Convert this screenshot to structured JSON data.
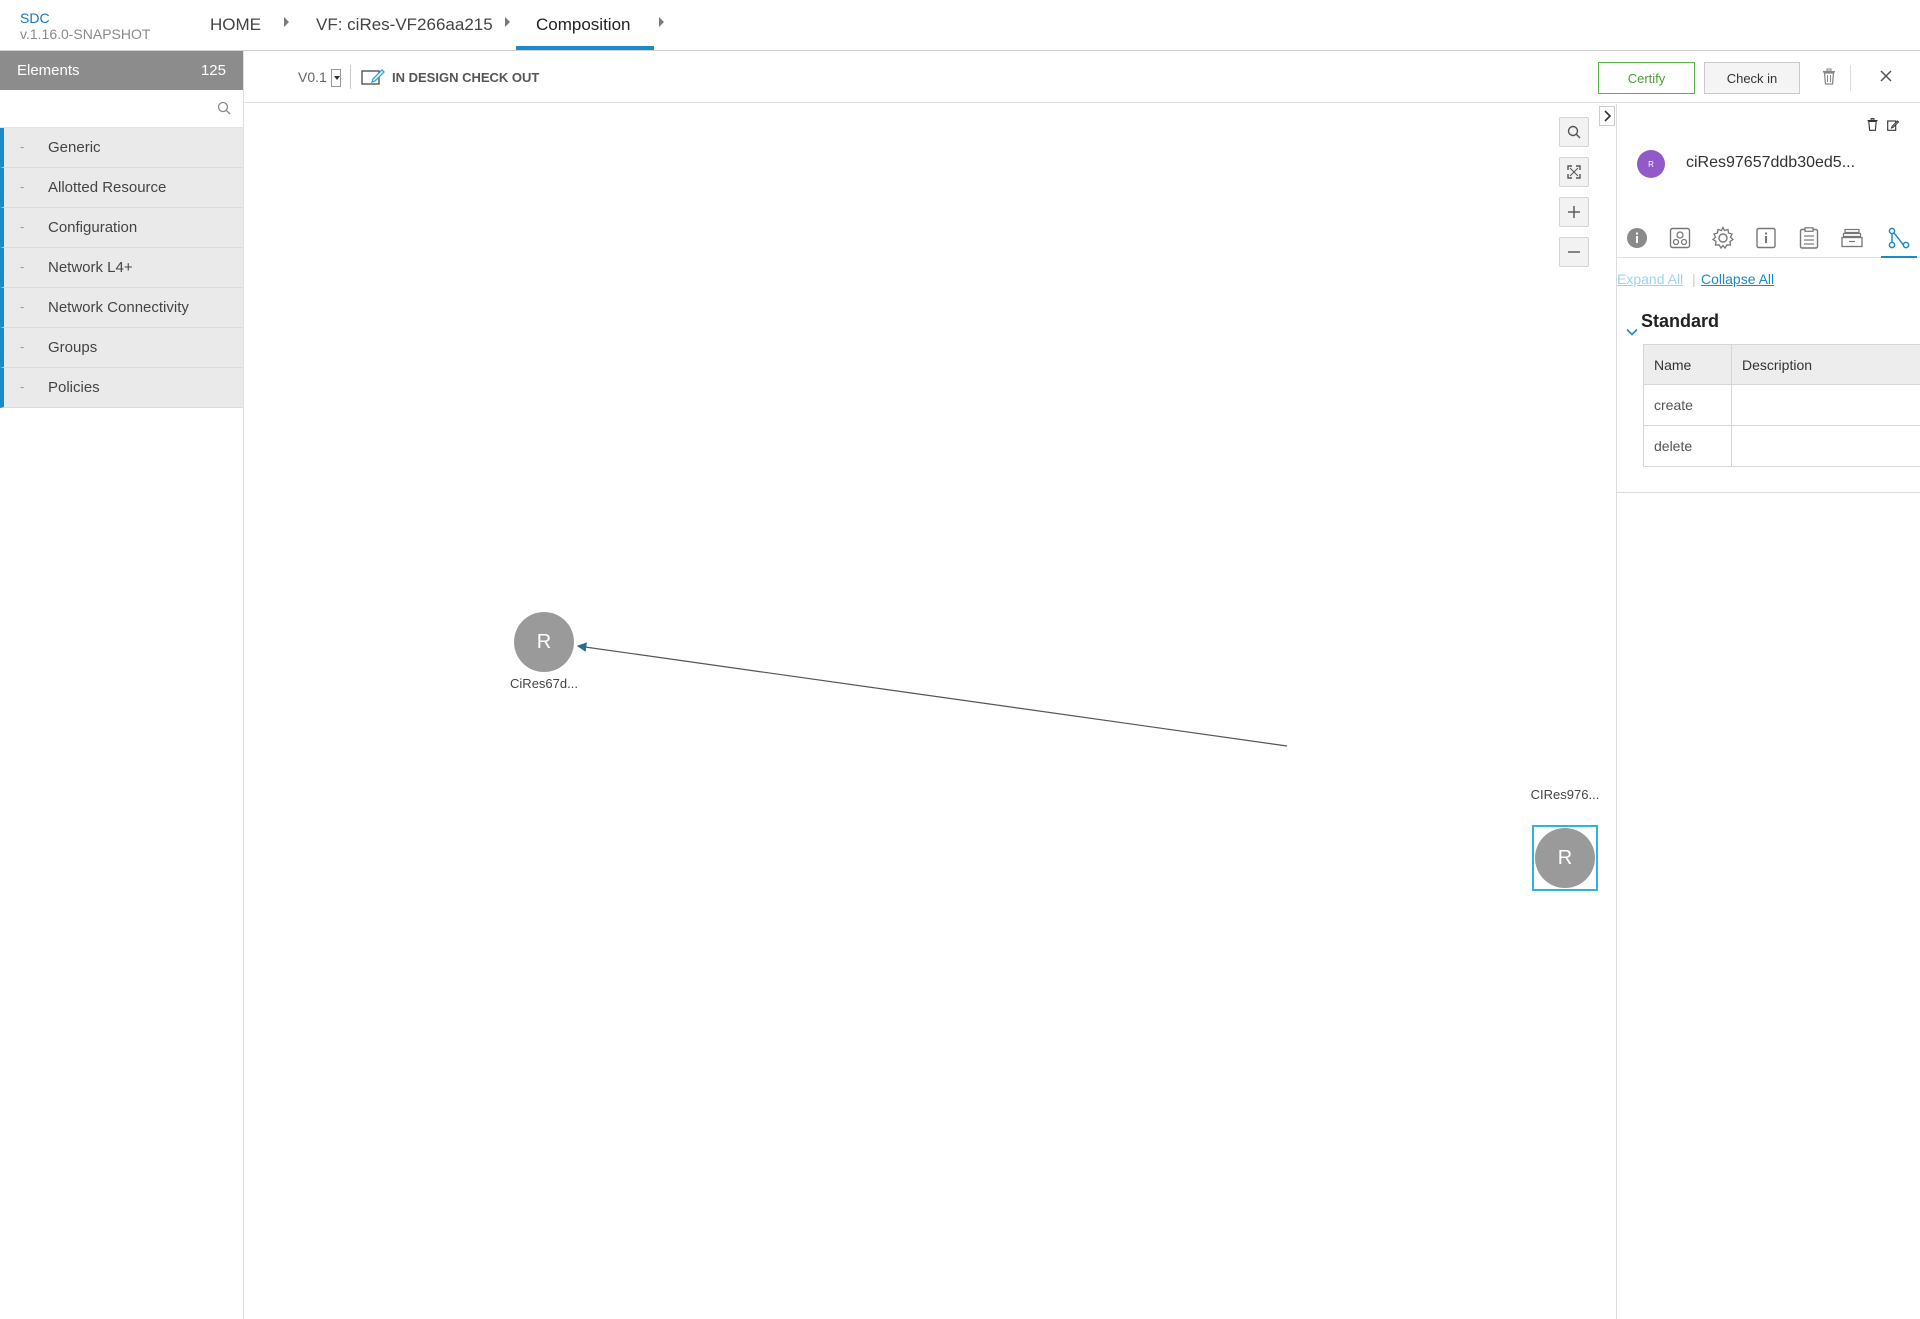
{
  "app": {
    "name": "SDC",
    "version": "v.1.16.0-SNAPSHOT"
  },
  "breadcrumbs": [
    {
      "label": "HOME"
    },
    {
      "label": "VF: ciRes-VF266aa215"
    },
    {
      "label": "Composition",
      "active": true
    }
  ],
  "palette": {
    "title": "Elements",
    "count": "125",
    "search_placeholder": "",
    "categories": [
      {
        "dash": "-",
        "label": "Generic"
      },
      {
        "dash": "-",
        "label": "Allotted Resource"
      },
      {
        "dash": "-",
        "label": "Configuration"
      },
      {
        "dash": "-",
        "label": "Network L4+"
      },
      {
        "dash": "-",
        "label": "Network Connectivity"
      },
      {
        "dash": "-",
        "label": "Groups"
      },
      {
        "dash": "-",
        "label": "Policies"
      }
    ]
  },
  "toolbar": {
    "version": "V0.1",
    "status": "IN DESIGN CHECK OUT",
    "certify_label": "Certify",
    "checkin_label": "Check in",
    "icons": {
      "status": "edit-checkout-icon",
      "trash": "trash-icon",
      "close": "close-icon"
    }
  },
  "canvas": {
    "zoom_controls": [
      "search-icon",
      "fit-screen-icon",
      "zoom-in-icon",
      "zoom-out-icon"
    ],
    "nodes": [
      {
        "letter": "R",
        "label": "CiRes67d..."
      },
      {
        "letter": "R",
        "label": "CIRes976...",
        "selected": true
      }
    ],
    "selection_color": "#2fb2e8",
    "node_color": "#9a9a9a",
    "edge_color": "#555555"
  },
  "right_panel": {
    "avatar_letter": "R",
    "avatar_color": "#9259c8",
    "title": "ciRes97657ddb30ed5...",
    "tabs": [
      "info-icon",
      "deployment-artifacts-icon",
      "properties-gear-icon",
      "api-info-icon",
      "composition-clipboard-icon",
      "artifacts-stack-icon",
      "relations-icon"
    ],
    "active_tab": "relations-icon",
    "expand_all": "Expand All",
    "separator": "|",
    "collapse_all": "Collapse All",
    "section_title": "Standard",
    "table": {
      "headers": [
        "Name",
        "Description"
      ],
      "rows": [
        {
          "name": "create",
          "description": ""
        },
        {
          "name": "delete",
          "description": ""
        }
      ]
    }
  },
  "accent_color": "#1b8ac9"
}
